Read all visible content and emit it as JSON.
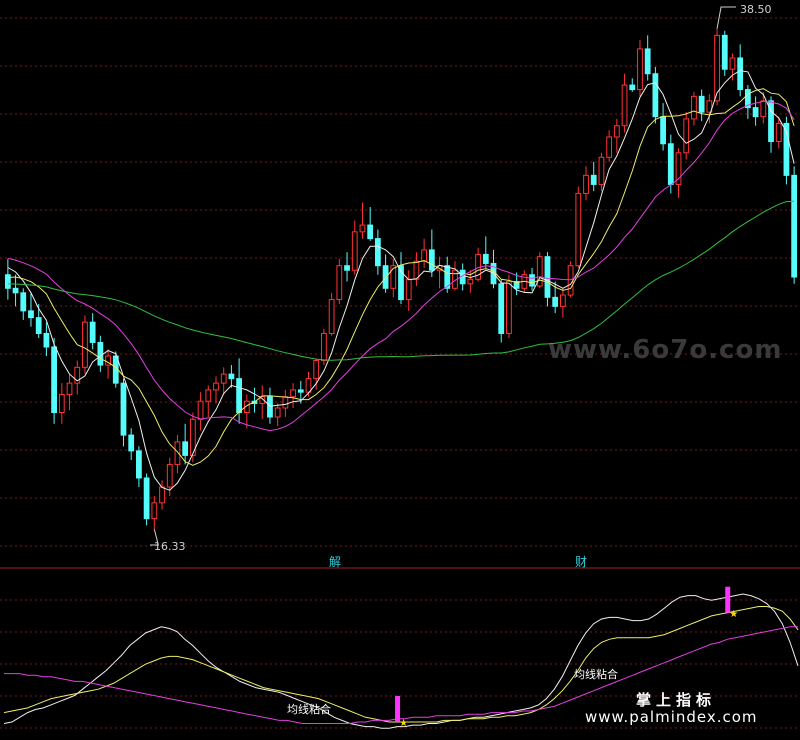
{
  "colors": {
    "up": "#ff3333",
    "down": "#54fcfc",
    "ma_white": "#f0f0f0",
    "ma_yellow": "#eeee66",
    "ma_magenta": "#e040e0",
    "ma_green": "#30c040",
    "grid": "#7a1818",
    "signal_bar": "#ff33ff"
  },
  "annotations": {
    "high_label": "38.50",
    "low_label": "16.33",
    "event_1": "解",
    "event_2": "财",
    "signal_text": "均线粘合",
    "watermark_top": "www.6o7o.com",
    "watermark_bottom_title": "掌上指标",
    "watermark_bottom_url": "www.palmindex.com"
  },
  "chart_data": [
    {
      "type": "candlestick",
      "title": "",
      "xlabel": "",
      "ylabel": "",
      "ylim": [
        15.5,
        39.5
      ],
      "grid": true,
      "series": [
        {
          "name": "",
          "ohlc": [
            [
              27.6,
              28.3,
              26.5,
              27.0
            ],
            [
              27.0,
              27.6,
              26.2,
              26.8
            ],
            [
              26.8,
              27.0,
              25.6,
              26.0
            ],
            [
              26.0,
              26.8,
              25.3,
              25.7
            ],
            [
              25.7,
              26.3,
              24.8,
              25.0
            ],
            [
              25.0,
              25.5,
              24.0,
              24.4
            ],
            [
              24.4,
              24.8,
              21.0,
              21.5
            ],
            [
              21.5,
              22.8,
              21.0,
              22.3
            ],
            [
              22.3,
              23.2,
              21.6,
              22.8
            ],
            [
              22.8,
              23.8,
              22.3,
              23.5
            ],
            [
              23.5,
              25.8,
              23.2,
              25.5
            ],
            [
              25.5,
              25.9,
              24.3,
              24.6
            ],
            [
              24.6,
              24.9,
              23.3,
              23.6
            ],
            [
              23.6,
              24.3,
              23.0,
              24.0
            ],
            [
              24.0,
              24.2,
              22.6,
              22.8
            ],
            [
              22.8,
              23.0,
              20.0,
              20.5
            ],
            [
              20.5,
              20.8,
              19.4,
              19.8
            ],
            [
              19.8,
              20.0,
              18.2,
              18.6
            ],
            [
              18.6,
              18.8,
              16.5,
              16.8
            ],
            [
              16.8,
              17.8,
              16.33,
              17.5
            ],
            [
              17.5,
              18.5,
              17.2,
              18.2
            ],
            [
              18.2,
              19.5,
              17.8,
              19.2
            ],
            [
              19.2,
              20.5,
              18.8,
              20.2
            ],
            [
              20.2,
              21.0,
              19.2,
              19.6
            ],
            [
              19.6,
              21.5,
              19.3,
              21.2
            ],
            [
              21.2,
              22.4,
              20.7,
              22.0
            ],
            [
              22.0,
              22.7,
              21.3,
              22.5
            ],
            [
              22.5,
              23.1,
              21.9,
              22.8
            ],
            [
              22.8,
              23.5,
              22.3,
              23.2
            ],
            [
              23.2,
              23.6,
              22.6,
              23.0
            ],
            [
              23.0,
              23.9,
              21.0,
              21.5
            ],
            [
              21.5,
              22.3,
              20.8,
              22.0
            ],
            [
              22.0,
              22.6,
              21.5,
              21.9
            ],
            [
              21.9,
              22.7,
              21.2,
              22.2
            ],
            [
              22.2,
              22.6,
              21.0,
              21.3
            ],
            [
              21.3,
              21.9,
              20.9,
              21.7
            ],
            [
              21.7,
              22.5,
              21.3,
              22.2
            ],
            [
              22.2,
              22.8,
              21.7,
              22.5
            ],
            [
              22.5,
              22.9,
              21.9,
              22.4
            ],
            [
              22.4,
              23.3,
              22.2,
              23.0
            ],
            [
              23.0,
              23.9,
              22.5,
              23.8
            ],
            [
              23.8,
              25.2,
              23.6,
              25.0
            ],
            [
              25.0,
              26.8,
              24.9,
              26.5
            ],
            [
              26.5,
              28.3,
              26.3,
              28.0
            ],
            [
              28.0,
              28.6,
              27.3,
              27.8
            ],
            [
              27.8,
              30.0,
              27.6,
              29.5
            ],
            [
              29.5,
              30.8,
              29.2,
              29.8
            ],
            [
              29.8,
              30.6,
              29.1,
              29.2
            ],
            [
              29.2,
              29.6,
              27.6,
              28.0
            ],
            [
              28.0,
              28.5,
              26.8,
              27.0
            ],
            [
              27.0,
              28.3,
              26.6,
              28.0
            ],
            [
              28.0,
              28.6,
              26.3,
              26.5
            ],
            [
              26.5,
              27.8,
              26.0,
              27.4
            ],
            [
              27.4,
              28.6,
              27.1,
              28.2
            ],
            [
              28.2,
              29.2,
              27.9,
              28.7
            ],
            [
              28.7,
              29.6,
              27.5,
              27.8
            ],
            [
              27.8,
              28.4,
              27.0,
              28.0
            ],
            [
              28.0,
              28.4,
              26.8,
              27.0
            ],
            [
              27.0,
              28.2,
              26.9,
              27.8
            ],
            [
              27.8,
              28.1,
              26.9,
              27.2
            ],
            [
              27.2,
              27.8,
              26.8,
              27.4
            ],
            [
              27.4,
              28.8,
              27.3,
              28.5
            ],
            [
              28.5,
              29.3,
              27.9,
              28.1
            ],
            [
              28.1,
              28.7,
              27.0,
              27.2
            ],
            [
              27.2,
              27.4,
              24.6,
              25.0
            ],
            [
              25.0,
              27.6,
              24.8,
              27.3
            ],
            [
              27.3,
              27.7,
              26.7,
              27.0
            ],
            [
              27.0,
              27.8,
              26.8,
              27.6
            ],
            [
              27.6,
              27.9,
              26.9,
              27.1
            ],
            [
              27.1,
              28.6,
              27.0,
              28.4
            ],
            [
              28.4,
              28.6,
              26.2,
              26.6
            ],
            [
              26.6,
              27.3,
              25.9,
              26.2
            ],
            [
              26.2,
              27.0,
              25.7,
              26.7
            ],
            [
              26.7,
              28.2,
              26.6,
              28.0
            ],
            [
              28.0,
              31.5,
              27.9,
              31.2
            ],
            [
              31.2,
              32.4,
              30.9,
              32.0
            ],
            [
              32.0,
              32.6,
              31.3,
              31.6
            ],
            [
              31.6,
              33.0,
              31.3,
              32.8
            ],
            [
              32.8,
              34.0,
              32.6,
              33.7
            ],
            [
              33.7,
              34.5,
              33.0,
              34.2
            ],
            [
              34.2,
              36.5,
              33.9,
              36.0
            ],
            [
              36.0,
              36.3,
              35.7,
              35.8
            ],
            [
              35.8,
              38.0,
              35.5,
              37.6
            ],
            [
              37.6,
              38.2,
              36.2,
              36.5
            ],
            [
              36.5,
              36.8,
              34.3,
              34.6
            ],
            [
              34.6,
              35.2,
              33.1,
              33.4
            ],
            [
              33.4,
              33.8,
              31.2,
              31.6
            ],
            [
              31.6,
              33.2,
              31.0,
              33.0
            ],
            [
              33.0,
              34.8,
              32.7,
              34.5
            ],
            [
              34.5,
              35.7,
              34.2,
              35.5
            ],
            [
              35.5,
              35.8,
              34.4,
              34.8
            ],
            [
              34.8,
              35.6,
              34.3,
              35.3
            ],
            [
              35.3,
              38.5,
              35.1,
              38.2
            ],
            [
              38.2,
              38.4,
              36.4,
              36.7
            ],
            [
              36.7,
              37.4,
              36.2,
              37.2
            ],
            [
              37.2,
              37.8,
              35.5,
              35.8
            ],
            [
              35.8,
              36.0,
              34.5,
              35.0
            ],
            [
              35.0,
              35.5,
              34.2,
              34.6
            ],
            [
              34.6,
              35.7,
              34.3,
              35.3
            ],
            [
              35.3,
              35.5,
              33.0,
              33.5
            ],
            [
              33.5,
              34.6,
              33.2,
              34.3
            ],
            [
              34.3,
              34.6,
              31.6,
              32.0
            ],
            [
              32.0,
              32.4,
              27.2,
              27.5
            ]
          ]
        }
      ]
    },
    {
      "type": "line",
      "title": "",
      "series": [
        {
          "name": "",
          "values": [
            8,
            9,
            12,
            15,
            17,
            18,
            20,
            22,
            24,
            26,
            30,
            34,
            38,
            42,
            47,
            52,
            58,
            62,
            66,
            68,
            70,
            69,
            67,
            62,
            58,
            53,
            48,
            44,
            41,
            38,
            35,
            33,
            31,
            30,
            29,
            28,
            26,
            24,
            22,
            20,
            18,
            15,
            12,
            10,
            8,
            7,
            6,
            6,
            5,
            5,
            6,
            6,
            7,
            7,
            8,
            8,
            9,
            10,
            10,
            11,
            12,
            12,
            13,
            14,
            15,
            16,
            17,
            18,
            20,
            24,
            30,
            38,
            48,
            58,
            66,
            72,
            75,
            76,
            76,
            75,
            74,
            74,
            75,
            78,
            82,
            86,
            89,
            90,
            90,
            88,
            87,
            88,
            89,
            90,
            91,
            90,
            88,
            85,
            80,
            72,
            60,
            45
          ]
        },
        {
          "name": "",
          "values": [
            15,
            16,
            17,
            18,
            20,
            22,
            24,
            25,
            26,
            27,
            28,
            29,
            30,
            32,
            34,
            37,
            40,
            43,
            46,
            48,
            50,
            51,
            51,
            50,
            49,
            47,
            45,
            43,
            41,
            39,
            37,
            35,
            33,
            31,
            30,
            29,
            28,
            27,
            26,
            25,
            24,
            22,
            20,
            18,
            16,
            14,
            12,
            11,
            10,
            9,
            9,
            9,
            9,
            9,
            9,
            9,
            10,
            10,
            10,
            11,
            11,
            11,
            12,
            12,
            13,
            13,
            14,
            15,
            17,
            20,
            24,
            29,
            35,
            42,
            50,
            56,
            60,
            62,
            63,
            63,
            63,
            63,
            63,
            64,
            65,
            67,
            69,
            71,
            73,
            75,
            77,
            78,
            79,
            80,
            81,
            82,
            83,
            83,
            82,
            80,
            75,
            68
          ]
        },
        {
          "name": "",
          "values": [
            40,
            40,
            40,
            39,
            39,
            38,
            38,
            37,
            36,
            35,
            35,
            34,
            33,
            32,
            31,
            30,
            29,
            28,
            27,
            26,
            25,
            24,
            23,
            22,
            21,
            20,
            19,
            18,
            17,
            16,
            15,
            14,
            13,
            12,
            11,
            10,
            10,
            9,
            8,
            8,
            8,
            8,
            8,
            8,
            8,
            9,
            9,
            10,
            10,
            10,
            11,
            11,
            12,
            12,
            12,
            13,
            13,
            13,
            13,
            14,
            14,
            14,
            15,
            15,
            15,
            15,
            16,
            16,
            17,
            18,
            19,
            21,
            23,
            25,
            27,
            29,
            31,
            33,
            35,
            37,
            39,
            41,
            43,
            45,
            47,
            49,
            51,
            53,
            55,
            57,
            59,
            60,
            62,
            63,
            64,
            65,
            66,
            67,
            68,
            69,
            70,
            70
          ]
        }
      ],
      "signals": [
        {
          "index": 50,
          "value": 1
        },
        {
          "index": 92,
          "value": 1
        }
      ]
    }
  ]
}
